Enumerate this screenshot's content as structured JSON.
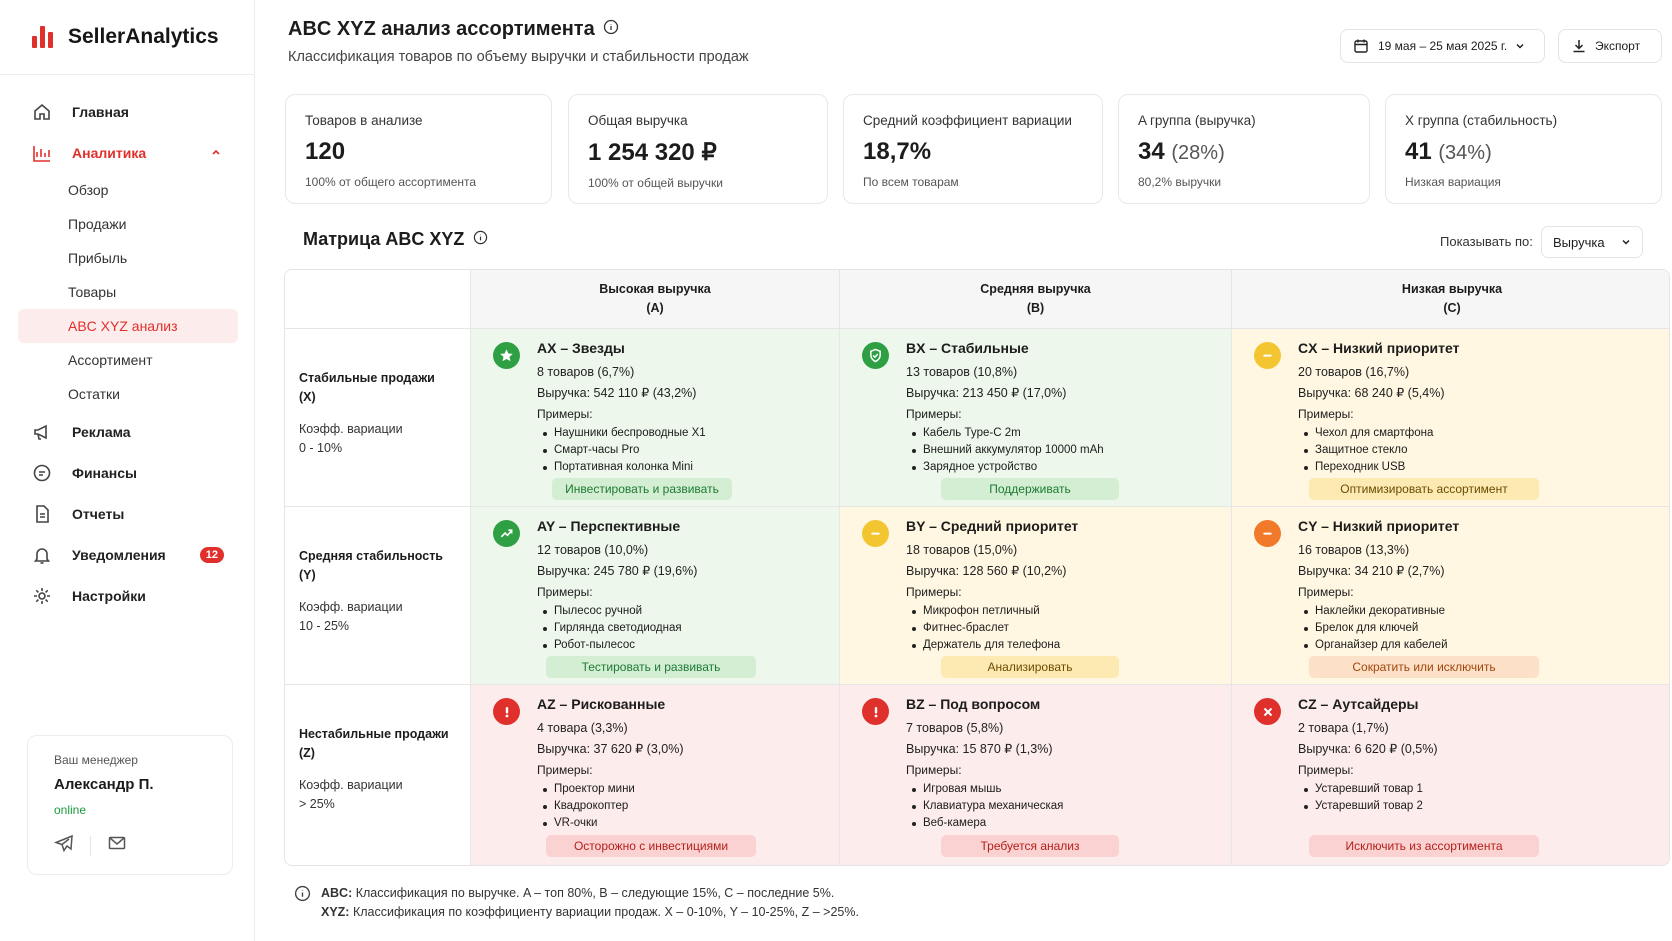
{
  "app": {
    "name": "SellerAnalytics"
  },
  "sidebar": {
    "items": [
      {
        "label": "Главная"
      },
      {
        "label": "Аналитика"
      },
      {
        "label": "Реклама"
      },
      {
        "label": "Финансы"
      },
      {
        "label": "Отчеты"
      },
      {
        "label": "Уведомления",
        "badge": "12"
      },
      {
        "label": "Настройки"
      }
    ],
    "subitems": [
      "Обзор",
      "Продажи",
      "Прибыль",
      "Товары",
      "ABC XYZ анализ",
      "Ассортимент",
      "Остатки"
    ]
  },
  "manager": {
    "label": "Ваш менеджер",
    "name": "Александр П.",
    "status": "online"
  },
  "header": {
    "title": "ABC XYZ анализ ассортимента",
    "subtitle": "Классификация товаров по объему выручки и стабильности продаж",
    "date_range": "19 мая – 25 мая 2025 г.",
    "export_label": "Экспорт"
  },
  "kpis": [
    {
      "label": "Товаров в анализе",
      "value": "120",
      "pct": "",
      "sub": "100% от общего ассортимента"
    },
    {
      "label": "Общая выручка",
      "value": "1 254 320 ₽",
      "pct": "",
      "sub": "100% от общей выручки"
    },
    {
      "label": "Средний коэффициент вариации",
      "value": "18,7%",
      "pct": "",
      "sub": "По всем товарам"
    },
    {
      "label": "A группа (выручка)",
      "value": "34",
      "pct": "(28%)",
      "sub": "80,2% выручки"
    },
    {
      "label": "X группа (стабильность)",
      "value": "41",
      "pct": "(34%)",
      "sub": "Низкая вариация"
    }
  ],
  "matrix": {
    "title": "Матрица ABC XYZ",
    "show_by_label": "Показывать по:",
    "show_by_value": "Выручка",
    "columns": [
      {
        "line1": "Высокая выручка",
        "line2": "(A)"
      },
      {
        "line1": "Средняя выручка",
        "line2": "(B)"
      },
      {
        "line1": "Низкая выручка",
        "line2": "(C)"
      }
    ],
    "rows": [
      {
        "title1": "Стабильные продажи",
        "title2": "(X)",
        "coef1": "Коэфф. вариации",
        "coef2": "0 - 10%"
      },
      {
        "title1": "Средняя стабильность",
        "title2": "(Y)",
        "coef1": "Коэфф. вариации",
        "coef2": "10 - 25%"
      },
      {
        "title1": "Нестабильные продажи",
        "title2": "(Z)",
        "coef1": "Коэфф. вариации",
        "coef2": "> 25%"
      }
    ],
    "examples_label": "Примеры:",
    "cells": [
      {
        "title": "AX – Звезды",
        "count": "8 товаров (6,7%)",
        "revenue": "Выручка: 542 110 ₽ (43,2%)",
        "examples": [
          "Наушники беспроводные X1",
          "Смарт-часы Pro",
          "Портативная колонка Mini"
        ],
        "action": "Инвестировать и развивать",
        "icon": "star-icon",
        "tone": "green"
      },
      {
        "title": "BX – Стабильные",
        "count": "13 товаров (10,8%)",
        "revenue": "Выручка: 213 450 ₽ (17,0%)",
        "examples": [
          "Кабель Type-C 2m",
          "Внешний аккумулятор 10000 mAh",
          "Зарядное устройство"
        ],
        "action": "Поддерживать",
        "icon": "shield-check-icon",
        "tone": "green"
      },
      {
        "title": "CX – Низкий приоритет",
        "count": "20 товаров (16,7%)",
        "revenue": "Выручка: 68 240 ₽ (5,4%)",
        "examples": [
          "Чехол для смартфона",
          "Защитное стекло",
          "Переходник USB"
        ],
        "action": "Оптимизировать ассортимент",
        "icon": "minus-circle-icon",
        "tone": "yellow"
      },
      {
        "title": "AY – Перспективные",
        "count": "12 товаров (10,0%)",
        "revenue": "Выручка: 245 780 ₽ (19,6%)",
        "examples": [
          "Пылесос ручной",
          "Гирлянда светодиодная",
          "Робот-пылесос"
        ],
        "action": "Тестировать и развивать",
        "icon": "trending-up-icon",
        "tone": "green"
      },
      {
        "title": "BY – Средний приоритет",
        "count": "18 товаров (15,0%)",
        "revenue": "Выручка: 128 560 ₽ (10,2%)",
        "examples": [
          "Микрофон петличный",
          "Фитнес-браслет",
          "Держатель для телефона"
        ],
        "action": "Анализировать",
        "icon": "minus-circle-icon",
        "tone": "yellow"
      },
      {
        "title": "CY – Низкий приоритет",
        "count": "16 товаров (13,3%)",
        "revenue": "Выручка: 34 210 ₽ (2,7%)",
        "examples": [
          "Наклейки декоративные",
          "Брелок для ключей",
          "Органайзер для кабелей"
        ],
        "action": "Сократить или исключить",
        "icon": "minus-circle-icon",
        "tone": "orange"
      },
      {
        "title": "AZ – Рискованные",
        "count": "4 товара (3,3%)",
        "revenue": "Выручка: 37 620 ₽ (3,0%)",
        "examples": [
          "Проектор мини",
          "Квадрокоптер",
          "VR-очки"
        ],
        "action": "Осторожно с инвестициями",
        "icon": "alert-icon",
        "tone": "red"
      },
      {
        "title": "BZ – Под вопросом",
        "count": "7 товаров (5,8%)",
        "revenue": "Выручка: 15 870 ₽ (1,3%)",
        "examples": [
          "Игровая мышь",
          "Клавиатура механическая",
          "Веб-камера"
        ],
        "action": "Требуется анализ",
        "icon": "alert-icon",
        "tone": "red"
      },
      {
        "title": "CZ – Аутсайдеры",
        "count": "2 товара (1,7%)",
        "revenue": "Выручка: 6 620 ₽ (0,5%)",
        "examples": [
          "Устаревший товар 1",
          "Устаревший товар 2"
        ],
        "action": "Исключить из ассортимента",
        "icon": "x-circle-icon",
        "tone": "red"
      }
    ]
  },
  "footnote": {
    "abc_label": "ABC:",
    "abc_text": "Классификация по выручке. A – топ 80%, B – следующие 15%, C – последние 5%.",
    "xyz_label": "XYZ:",
    "xyz_text": "Классификация по коэффициенту вариации продаж. X – 0-10%, Y – 10-25%, Z – >25%."
  },
  "colors": {
    "brand": "#e0302c",
    "green": "#2ea043",
    "yellow": "#f3c531",
    "orange": "#f07a2a",
    "red": "#e0302c"
  }
}
